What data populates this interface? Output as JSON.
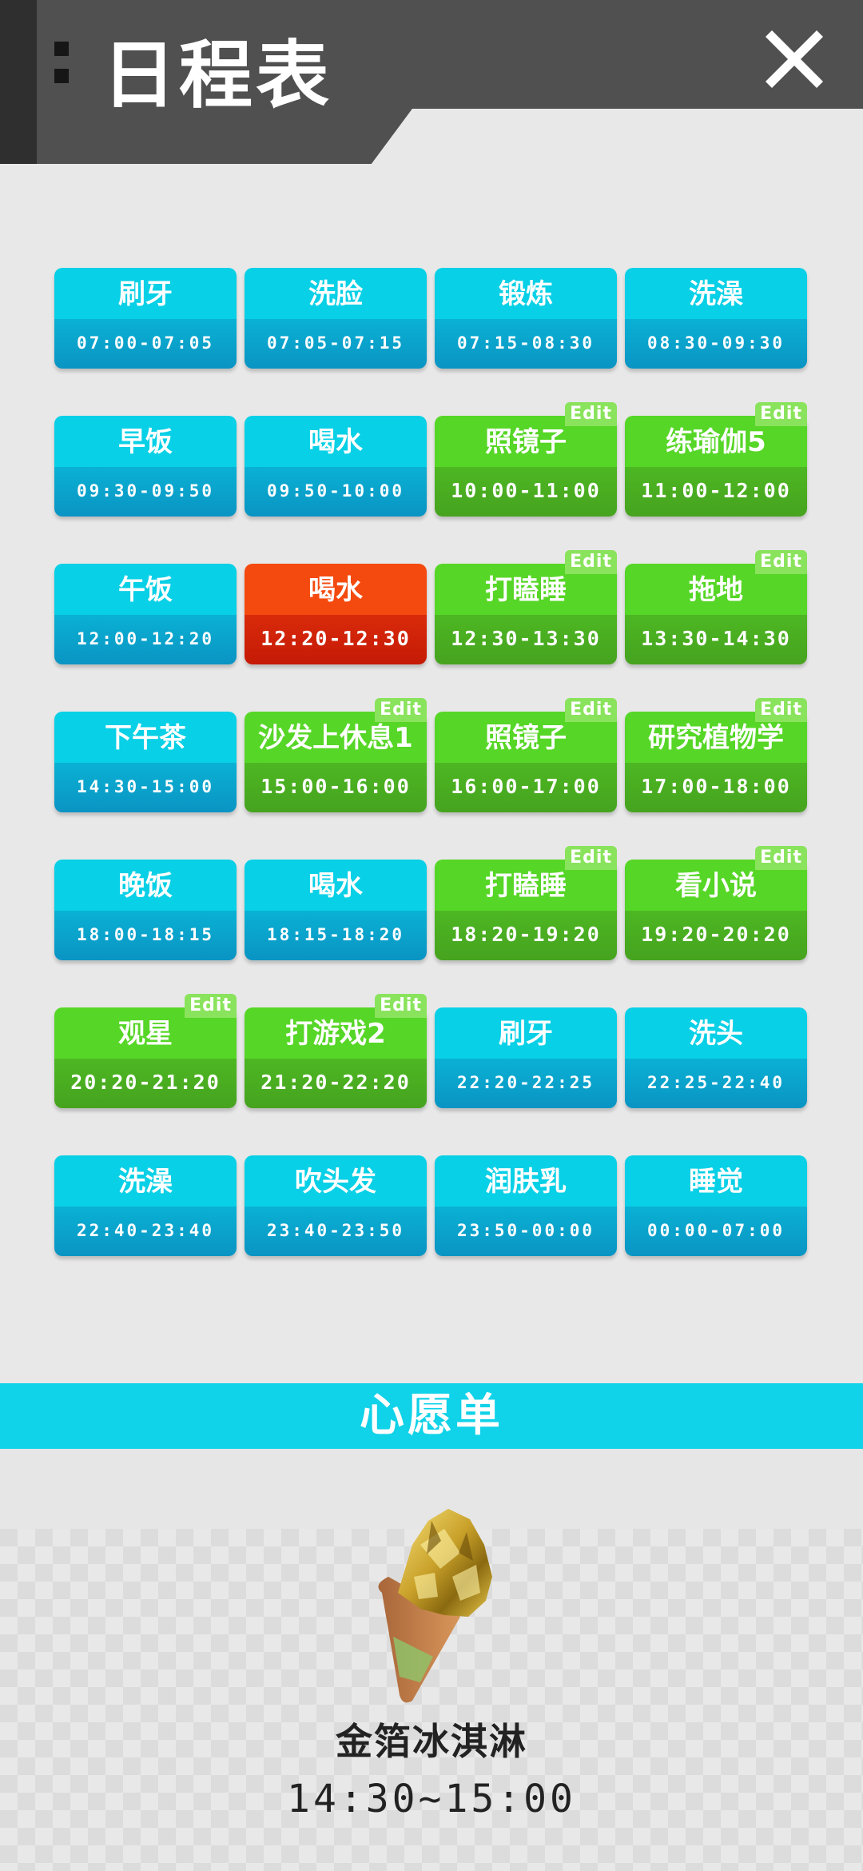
{
  "header": {
    "title": "日程表",
    "close_icon": "close-icon",
    "menu_icon": "grip-icon",
    "colors": {
      "bar": "#505050",
      "dark": "#2f2f2f"
    }
  },
  "schedule": {
    "rows": [
      [
        {
          "name": "刷牙",
          "time": "07:00-07:05",
          "color": "blue",
          "edit": false
        },
        {
          "name": "洗脸",
          "time": "07:05-07:15",
          "color": "blue",
          "edit": false
        },
        {
          "name": "锻炼",
          "time": "07:15-08:30",
          "color": "blue",
          "edit": false
        },
        {
          "name": "洗澡",
          "time": "08:30-09:30",
          "color": "blue",
          "edit": false
        }
      ],
      [
        {
          "name": "早饭",
          "time": "09:30-09:50",
          "color": "blue",
          "edit": false
        },
        {
          "name": "喝水",
          "time": "09:50-10:00",
          "color": "blue",
          "edit": false
        },
        {
          "name": "照镜子",
          "time": "10:00-11:00",
          "color": "green",
          "edit": true
        },
        {
          "name": "练瑜伽5",
          "time": "11:00-12:00",
          "color": "green",
          "edit": true
        }
      ],
      [
        {
          "name": "午饭",
          "time": "12:00-12:20",
          "color": "blue",
          "edit": false
        },
        {
          "name": "喝水",
          "time": "12:20-12:30",
          "color": "red",
          "edit": false
        },
        {
          "name": "打瞌睡",
          "time": "12:30-13:30",
          "color": "green",
          "edit": true
        },
        {
          "name": "拖地",
          "time": "13:30-14:30",
          "color": "green",
          "edit": true
        }
      ],
      [
        {
          "name": "下午茶",
          "time": "14:30-15:00",
          "color": "blue",
          "edit": false
        },
        {
          "name": "沙发上休息1",
          "time": "15:00-16:00",
          "color": "green",
          "edit": true
        },
        {
          "name": "照镜子",
          "time": "16:00-17:00",
          "color": "green",
          "edit": true
        },
        {
          "name": "研究植物学",
          "time": "17:00-18:00",
          "color": "green",
          "edit": true
        }
      ],
      [
        {
          "name": "晚饭",
          "time": "18:00-18:15",
          "color": "blue",
          "edit": false
        },
        {
          "name": "喝水",
          "time": "18:15-18:20",
          "color": "blue",
          "edit": false
        },
        {
          "name": "打瞌睡",
          "time": "18:20-19:20",
          "color": "green",
          "edit": true
        },
        {
          "name": "看小说",
          "time": "19:20-20:20",
          "color": "green",
          "edit": true
        }
      ],
      [
        {
          "name": "观星",
          "time": "20:20-21:20",
          "color": "green",
          "edit": true
        },
        {
          "name": "打游戏2",
          "time": "21:20-22:20",
          "color": "green",
          "edit": true
        },
        {
          "name": "刷牙",
          "time": "22:20-22:25",
          "color": "blue",
          "edit": false
        },
        {
          "name": "洗头",
          "time": "22:25-22:40",
          "color": "blue",
          "edit": false
        }
      ],
      [
        {
          "name": "洗澡",
          "time": "22:40-23:40",
          "color": "blue",
          "edit": false
        },
        {
          "name": "吹头发",
          "time": "23:40-23:50",
          "color": "blue",
          "edit": false
        },
        {
          "name": "润肤乳",
          "time": "23:50-00:00",
          "color": "blue",
          "edit": false
        },
        {
          "name": "睡觉",
          "time": "00:00-07:00",
          "color": "blue",
          "edit": false
        }
      ]
    ],
    "edit_label": "Edit",
    "colors": {
      "blue": "#08d0e6",
      "green": "#56d626",
      "red": "#f44a0f"
    }
  },
  "wishlist": {
    "title": "心愿单",
    "item_name": "金箔冰淇淋",
    "item_time": "14:30~15:00",
    "item_icon": "gold-leaf-ice-cream-icon",
    "color": "#10d2e8"
  }
}
